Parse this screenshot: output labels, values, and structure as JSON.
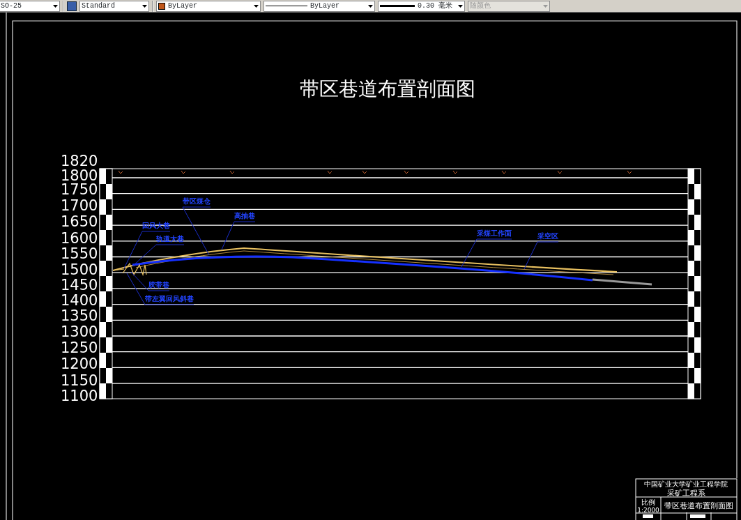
{
  "toolbar": {
    "dimension_style": "SO-25",
    "text_style": "Standard",
    "color": {
      "label": "ByLayer"
    },
    "linetype": "ByLayer",
    "lineweight": "0.30 毫米",
    "plot_style": {
      "label": "随颜色",
      "disabled": true
    }
  },
  "drawing": {
    "title": "带区巷道布置剖面图",
    "elevation_labels": [
      "1820",
      "1800",
      "1750",
      "1700",
      "1650",
      "1600",
      "1550",
      "1500",
      "1450",
      "1400",
      "1350",
      "1300",
      "1250",
      "1200",
      "1150",
      "1100"
    ],
    "annotations": [
      {
        "text": "带区煤仓"
      },
      {
        "text": "高抽巷"
      },
      {
        "text": "回风大巷"
      },
      {
        "text": "轨道大巷"
      },
      {
        "text": "胶带巷"
      },
      {
        "text": "带左翼回风斜巷"
      },
      {
        "text": "采煤工作面"
      },
      {
        "text": "采空区"
      }
    ],
    "title_block": {
      "school": "中国矿业大学矿业工程学院",
      "department": "采矿工程系",
      "scale_label": "比例",
      "scale": "1:2000",
      "drawing_name": "带区巷道布置剖面图"
    }
  }
}
